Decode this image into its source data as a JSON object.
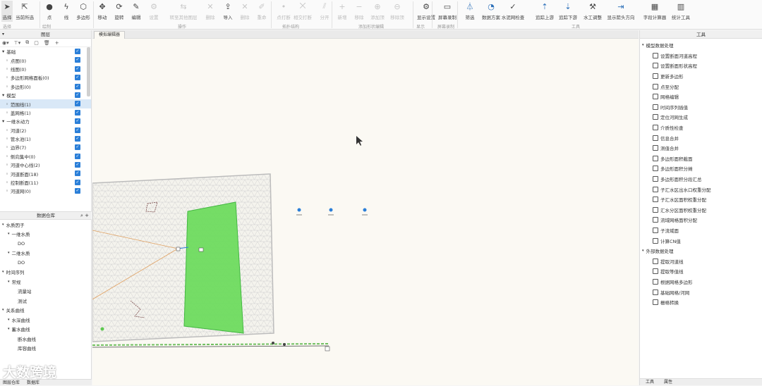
{
  "ribbon": {
    "buttons": [
      {
        "label": "选择",
        "icon": "arrow-select-icon",
        "selected": true,
        "disabled": false
      },
      {
        "label": "当前所选",
        "icon": "multi-select-icon",
        "disabled": false
      },
      {
        "label": "点",
        "icon": "point-icon",
        "disabled": false
      },
      {
        "label": "线",
        "icon": "line-icon",
        "disabled": false
      },
      {
        "label": "多边形",
        "icon": "polygon-icon",
        "disabled": false
      },
      {
        "label": "移动",
        "icon": "move-icon",
        "disabled": false
      },
      {
        "label": "旋转",
        "icon": "rotate-icon",
        "disabled": false
      },
      {
        "label": "编辑",
        "icon": "pencil-icon",
        "disabled": false
      },
      {
        "label": "设置",
        "icon": "settings-icon",
        "disabled": true
      },
      {
        "label": "转至其他图层",
        "icon": "transfer-icon",
        "disabled": true
      },
      {
        "label": "删除",
        "icon": "delete-icon",
        "disabled": true
      },
      {
        "label": "导入",
        "icon": "import-icon",
        "disabled": false
      },
      {
        "label": "删除",
        "icon": "delete-icon",
        "disabled": true
      },
      {
        "label": "重命",
        "icon": "rename-icon",
        "disabled": true
      },
      {
        "label": "点打断",
        "icon": "point-break-icon",
        "disabled": true
      },
      {
        "label": "相交打断",
        "icon": "intersect-break-icon",
        "disabled": true
      },
      {
        "label": "分开",
        "icon": "split-icon",
        "disabled": true
      },
      {
        "label": "新增",
        "icon": "add-icon",
        "disabled": true
      },
      {
        "label": "移除",
        "icon": "remove-icon",
        "disabled": true
      },
      {
        "label": "添加顶",
        "icon": "add-vertex-icon",
        "disabled": true
      },
      {
        "label": "移除顶",
        "icon": "remove-vertex-icon",
        "disabled": true
      },
      {
        "label": "显示设置",
        "icon": "gear-icon",
        "disabled": false
      },
      {
        "label": "屏幕录制",
        "icon": "video-icon",
        "disabled": false
      },
      {
        "label": "筛选",
        "icon": "filter-icon",
        "disabled": false
      },
      {
        "label": "数据方案",
        "icon": "pie-icon",
        "disabled": false
      },
      {
        "label": "水泥网检查",
        "icon": "check-icon",
        "disabled": false
      },
      {
        "label": "追踪上游",
        "icon": "upstream-icon",
        "disabled": false
      },
      {
        "label": "追踪下游",
        "icon": "downstream-icon",
        "disabled": false
      },
      {
        "label": "水工调整",
        "icon": "adjust-icon",
        "disabled": false
      },
      {
        "label": "显示箭头方向",
        "icon": "direction-icon",
        "disabled": false
      },
      {
        "label": "字段计算器",
        "icon": "calculator-icon",
        "disabled": false
      },
      {
        "label": "统计工具",
        "icon": "bar-chart-icon",
        "disabled": false
      }
    ],
    "groups": [
      "选择",
      "绘制",
      "操作",
      "拓扑结构",
      "添加形状编辑",
      "显示",
      "屏幕录制",
      "工具"
    ]
  },
  "left_panel": {
    "title": "图层",
    "layers": [
      {
        "label": "基础",
        "type": "group",
        "checked": true
      },
      {
        "label": "点图(0)",
        "type": "item",
        "checked": true
      },
      {
        "label": "线图(0)",
        "type": "item",
        "checked": true
      },
      {
        "label": "多边形网格面板(0)",
        "type": "item",
        "checked": true
      },
      {
        "label": "多边形(0)",
        "type": "item",
        "checked": true
      },
      {
        "label": "模型",
        "type": "group",
        "checked": true
      },
      {
        "label": "范围线(1)",
        "type": "item",
        "checked": true,
        "highlight": true
      },
      {
        "label": "盖网格(1)",
        "type": "item",
        "checked": true
      },
      {
        "label": "一维水动力",
        "type": "group",
        "checked": true
      },
      {
        "label": "河道(2)",
        "type": "item",
        "checked": true
      },
      {
        "label": "管水池(1)",
        "type": "item",
        "checked": true
      },
      {
        "label": "边界(7)",
        "type": "item",
        "checked": true
      },
      {
        "label": "侧向集中(0)",
        "type": "item",
        "checked": true
      },
      {
        "label": "河道中心线(2)",
        "type": "item",
        "checked": true
      },
      {
        "label": "河道断面(18)",
        "type": "item",
        "checked": true
      },
      {
        "label": "控制断面(11)",
        "type": "item",
        "checked": true
      },
      {
        "label": "河道网(0)",
        "type": "item",
        "checked": true
      }
    ],
    "data_section": {
      "title": "数据仓库",
      "tree": [
        {
          "label": "水质因子",
          "level": 0
        },
        {
          "label": "一维水质",
          "level": 1
        },
        {
          "label": "DO",
          "level": 2
        },
        {
          "label": "二维水质",
          "level": 1
        },
        {
          "label": "DO",
          "level": 2
        },
        {
          "label": "时间序列",
          "level": 0
        },
        {
          "label": "常规",
          "level": 1
        },
        {
          "label": "流量站",
          "level": 2
        },
        {
          "label": "测试",
          "level": 2
        },
        {
          "label": "关系曲线",
          "level": 0
        },
        {
          "label": "水深曲线",
          "level": 1
        },
        {
          "label": "蓄水曲线",
          "level": 1
        },
        {
          "label": "断水曲线",
          "level": 2
        },
        {
          "label": "库容曲线",
          "level": 2
        }
      ]
    },
    "bottom_tabs": [
      "图层仓库",
      "数据库"
    ]
  },
  "canvas": {
    "tab_label": "模拟编辑器"
  },
  "right_panel": {
    "title": "工具",
    "items": [
      {
        "label": "模型数据处理",
        "type": "category"
      },
      {
        "label": "设置断面河道高程",
        "type": "item"
      },
      {
        "label": "设置断面形状高程",
        "type": "item"
      },
      {
        "label": "更新多边形",
        "type": "item"
      },
      {
        "label": "点至分配",
        "type": "item"
      },
      {
        "label": "网格编辑",
        "type": "item"
      },
      {
        "label": "时间序列插值",
        "type": "item"
      },
      {
        "label": "定位河网生成",
        "type": "item"
      },
      {
        "label": "介质性检查",
        "type": "item"
      },
      {
        "label": "信息合并",
        "type": "item"
      },
      {
        "label": "测值合并",
        "type": "item"
      },
      {
        "label": "多边形面积截面",
        "type": "item"
      },
      {
        "label": "多边形面积分摊",
        "type": "item"
      },
      {
        "label": "多边形面积分段汇总",
        "type": "item"
      },
      {
        "label": "子汇水区出水口权重分配",
        "type": "item"
      },
      {
        "label": "子汇水区面积权重分配",
        "type": "item"
      },
      {
        "label": "汇水分区面积权重分配",
        "type": "item"
      },
      {
        "label": "流域网格面积分配",
        "type": "item"
      },
      {
        "label": "子流域面",
        "type": "item"
      },
      {
        "label": "计算CN值",
        "type": "item"
      },
      {
        "label": "外部数据处理",
        "type": "category"
      },
      {
        "label": "提取河道线",
        "type": "item"
      },
      {
        "label": "提取等值线",
        "type": "item"
      },
      {
        "label": "根据网格多边形",
        "type": "item"
      },
      {
        "label": "基础网格/河网",
        "type": "item"
      },
      {
        "label": "栅格转换",
        "type": "item"
      }
    ],
    "bottom_tabs": [
      "工具",
      "属性"
    ]
  },
  "watermark": "大数跨境",
  "colors": {
    "accent": "#2b7fd8",
    "polygon_fill": "#6fdc5f",
    "mesh_line": "#cfcfcf",
    "orange_line": "#e0a060"
  }
}
